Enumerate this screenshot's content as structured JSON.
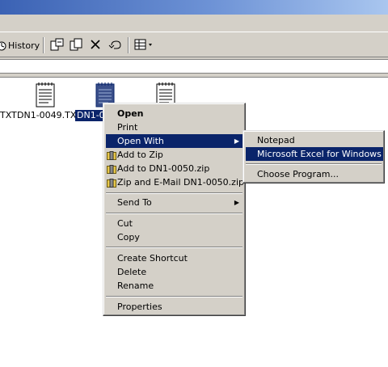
{
  "toolbar": {
    "history_label": "History"
  },
  "files": [
    {
      "label": "TXT",
      "selected": false
    },
    {
      "label": "DN1-0049.TXT",
      "selected": false
    },
    {
      "label": "DN1-0",
      "selected": true
    }
  ],
  "context_menu": {
    "open": "Open",
    "print": "Print",
    "open_with": "Open With",
    "add_to_zip": "Add to Zip",
    "add_to_named_zip": "Add to DN1-0050.zip",
    "zip_and_email": "Zip and E-Mail DN1-0050.zip",
    "send_to": "Send To",
    "cut": "Cut",
    "copy": "Copy",
    "create_shortcut": "Create Shortcut",
    "delete": "Delete",
    "rename": "Rename",
    "properties": "Properties"
  },
  "open_with_menu": {
    "notepad": "Notepad",
    "excel": "Microsoft Excel for Windows",
    "choose": "Choose Program..."
  },
  "colors": {
    "selection": "#0a246a",
    "chrome": "#d4d0c8",
    "title_gradient_start": "#3b62b4"
  }
}
